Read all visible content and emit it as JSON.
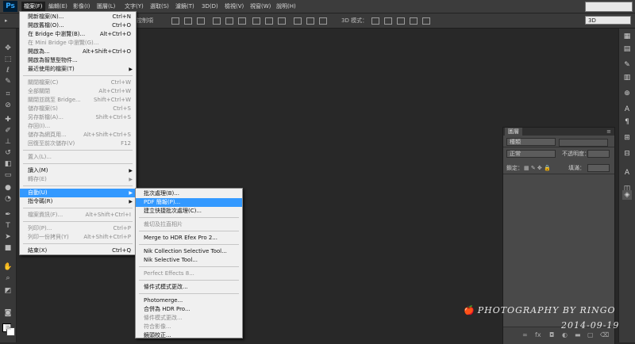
{
  "app": {
    "logo": "Ps"
  },
  "menubar": {
    "items": [
      "檔案(F)",
      "編輯(E)",
      "影像(I)",
      "圖層(L)",
      "文字(Y)",
      "選取(S)",
      "濾鏡(T)",
      "3D(D)",
      "檢視(V)",
      "視窗(W)",
      "說明(H)"
    ]
  },
  "options": {
    "partial_text": "控制項",
    "mode_label": "3D 模式：",
    "mode_value": "3D"
  },
  "file_menu": {
    "items": [
      {
        "label": "開新檔案(N)...",
        "shortcut": "Ctrl+N",
        "disabled": false
      },
      {
        "label": "開啟舊檔(O)...",
        "shortcut": "Ctrl+O",
        "disabled": false
      },
      {
        "label": "在 Bridge 中瀏覽(B)...",
        "shortcut": "Alt+Ctrl+O",
        "disabled": false
      },
      {
        "label": "在 Mini Bridge 中瀏覽(G)...",
        "shortcut": "",
        "disabled": true
      },
      {
        "label": "開啟為...",
        "shortcut": "Alt+Shift+Ctrl+O",
        "disabled": false
      },
      {
        "label": "開啟為智慧型物件...",
        "shortcut": "",
        "disabled": false
      },
      {
        "label": "最近使用的檔案(T)",
        "shortcut": "",
        "disabled": false,
        "submenu": true
      },
      {
        "sep": true
      },
      {
        "label": "關閉檔案(C)",
        "shortcut": "Ctrl+W",
        "disabled": true
      },
      {
        "label": "全部關閉",
        "shortcut": "Alt+Ctrl+W",
        "disabled": true
      },
      {
        "label": "關閉並跳至 Bridge...",
        "shortcut": "Shift+Ctrl+W",
        "disabled": true
      },
      {
        "label": "儲存檔案(S)",
        "shortcut": "Ctrl+S",
        "disabled": true
      },
      {
        "label": "另存新檔(A)...",
        "shortcut": "Shift+Ctrl+S",
        "disabled": true
      },
      {
        "label": "存回(I)...",
        "shortcut": "",
        "disabled": true
      },
      {
        "label": "儲存為網頁用...",
        "shortcut": "Alt+Shift+Ctrl+S",
        "disabled": true
      },
      {
        "label": "回復至前次儲存(V)",
        "shortcut": "F12",
        "disabled": true
      },
      {
        "sep": true
      },
      {
        "label": "置入(L)...",
        "shortcut": "",
        "disabled": true
      },
      {
        "sep": true
      },
      {
        "label": "讀入(M)",
        "shortcut": "",
        "disabled": false,
        "submenu": true
      },
      {
        "label": "轉存(E)",
        "shortcut": "",
        "disabled": true,
        "submenu": true
      },
      {
        "sep": true
      },
      {
        "label": "自動(U)",
        "shortcut": "",
        "disabled": false,
        "submenu": true,
        "highlight": true
      },
      {
        "label": "指令碼(R)",
        "shortcut": "",
        "disabled": false,
        "submenu": true
      },
      {
        "sep": true
      },
      {
        "label": "檔案資訊(F)...",
        "shortcut": "Alt+Shift+Ctrl+I",
        "disabled": true
      },
      {
        "sep": true
      },
      {
        "label": "列印(P)...",
        "shortcut": "Ctrl+P",
        "disabled": true
      },
      {
        "label": "列印一份拷貝(Y)",
        "shortcut": "Alt+Shift+Ctrl+P",
        "disabled": true
      },
      {
        "sep": true
      },
      {
        "label": "結束(X)",
        "shortcut": "Ctrl+Q",
        "disabled": false
      }
    ]
  },
  "automate_menu": {
    "items": [
      {
        "label": "批次處理(B)...",
        "disabled": false
      },
      {
        "label": "PDF 簡報(P)...",
        "disabled": false,
        "highlight": true
      },
      {
        "label": "建立快捷批次處理(C)...",
        "disabled": false
      },
      {
        "sep": true
      },
      {
        "label": "裁切及拉直相片",
        "disabled": true
      },
      {
        "sep": true
      },
      {
        "label": "Merge to HDR Efex Pro 2...",
        "disabled": false
      },
      {
        "sep": true
      },
      {
        "label": "Nik Collection Selective Tool...",
        "disabled": false
      },
      {
        "label": "Nik Selective Tool...",
        "disabled": false
      },
      {
        "sep": true
      },
      {
        "label": "Perfect Effects 8...",
        "disabled": true
      },
      {
        "sep": true
      },
      {
        "label": "條件式模式更改...",
        "disabled": false
      },
      {
        "sep": true
      },
      {
        "label": "Photomerge...",
        "disabled": false
      },
      {
        "label": "合併為 HDR Pro...",
        "disabled": false
      },
      {
        "label": "條件模式更改...",
        "disabled": true
      },
      {
        "label": "符合影像...",
        "disabled": true
      },
      {
        "label": "鏡頭校正...",
        "disabled": false
      }
    ]
  },
  "layers_panel": {
    "tab": "圖層",
    "kind_label": "種類",
    "blend_mode": "正常",
    "opacity_label": "不透明度：",
    "lock_label": "鎖定：",
    "fill_label": "填滿："
  },
  "watermark": {
    "line1": "PHOTOGRAPHY BY RINGO",
    "line2": "2014-09-19"
  }
}
